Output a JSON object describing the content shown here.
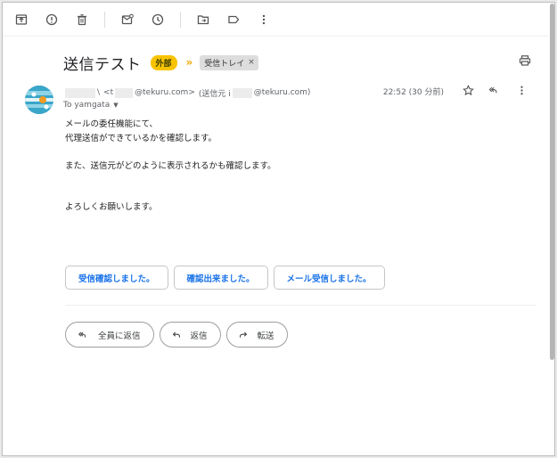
{
  "toolbar": {
    "icons": [
      "archive-icon",
      "report-spam-icon",
      "delete-icon",
      "mark-unread-icon",
      "snooze-icon",
      "move-to-icon",
      "label-icon",
      "more-vert-icon"
    ]
  },
  "subject": {
    "text": "送信テスト",
    "external_label": "外部",
    "inbox_label": "受信トレイ",
    "inbox_remove": "×"
  },
  "sender": {
    "name_fragment": "\\",
    "addr_prefix": "<t",
    "addr_domain": "@tekuru.com>",
    "via_prefix": "(送信元 i",
    "via_domain": "@tekuru.com)",
    "time": "22:52 (30 分前)",
    "to": "To yamgata"
  },
  "body": {
    "line1": "メールの委任機能にて、",
    "line2": "代理送信ができているかを確認します。",
    "line3": "また、送信元がどのように表示されるかも確認します。",
    "line4": "よろしくお願いします。"
  },
  "smart_replies": [
    "受信確認しました。",
    "確認出来ました。",
    "メール受信しました。"
  ],
  "actions": {
    "reply_all": "全員に返信",
    "reply": "返信",
    "forward": "転送"
  },
  "colors": {
    "accent": "#1a73e8",
    "external_badge": "#f8c300",
    "importance": "#f2a600"
  }
}
